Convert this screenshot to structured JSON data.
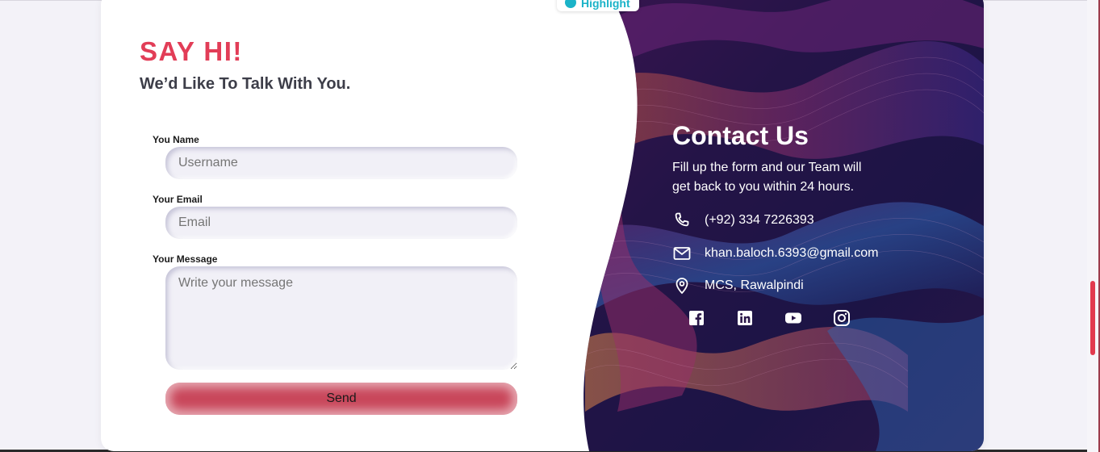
{
  "highlight_chip": {
    "label": "Highlight"
  },
  "form": {
    "heading": "SAY HI!",
    "subheading": "We’d Like To Talk With You.",
    "name_label": "You Name",
    "name_placeholder": "Username",
    "email_label": "Your Email",
    "email_placeholder": "Email",
    "message_label": "Your Message",
    "message_placeholder": "Write your message",
    "send_label": "Send"
  },
  "contact": {
    "title": "Contact Us",
    "description": "Fill up the form and our Team will get back to you within 24 hours.",
    "phone": "(+92) 334 7226393",
    "email": "khan.baloch.6393@gmail.com",
    "location": "MCS, Rawalpindi",
    "socials": [
      "facebook-icon",
      "linkedin-icon",
      "youtube-icon",
      "instagram-icon"
    ]
  },
  "colors": {
    "accent": "#e23d57",
    "button": "#c9475b",
    "panel_dark": "#1e1347",
    "scroll_thumb": "#e23a4e"
  }
}
